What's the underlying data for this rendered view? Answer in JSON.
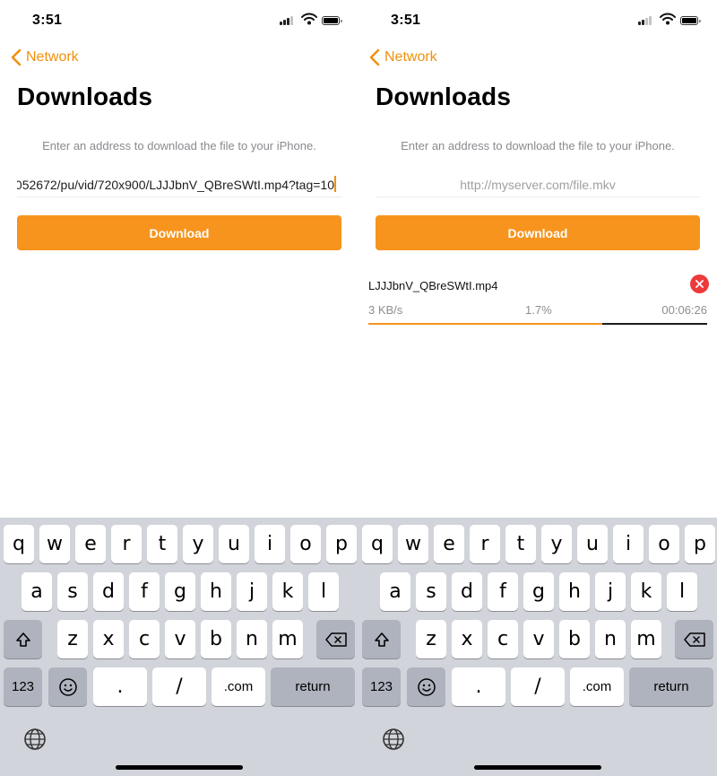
{
  "status_time": "3:51",
  "nav_back_label": "Network",
  "page_title": "Downloads",
  "hint_text": "Enter an address to download the file to your iPhone.",
  "download_button_label": "Download",
  "left_screen": {
    "url_value": "052672/pu/vid/720x900/LJJJbnV_QBreSWtI.mp4?tag=10"
  },
  "right_screen": {
    "url_placeholder": "http://myserver.com/file.mkv",
    "download_item": {
      "filename": "LJJJbnV_QBreSWtI.mp4",
      "speed": "3 KB/s",
      "percent": "1.7%",
      "time_remaining": "00:06:26",
      "progress_fraction": 0.69
    }
  },
  "keyboard": {
    "row1": [
      "q",
      "w",
      "e",
      "r",
      "t",
      "y",
      "u",
      "i",
      "o",
      "p"
    ],
    "row2": [
      "a",
      "s",
      "d",
      "f",
      "g",
      "h",
      "j",
      "k",
      "l"
    ],
    "row3": [
      "z",
      "x",
      "c",
      "v",
      "b",
      "n",
      "m"
    ],
    "row4": [
      "123",
      ".",
      "/",
      ".com",
      "return"
    ]
  },
  "colors": {
    "accent": "#f7941d",
    "cancel": "#ed3b3b",
    "keyboard_bg": "#d1d4da"
  }
}
